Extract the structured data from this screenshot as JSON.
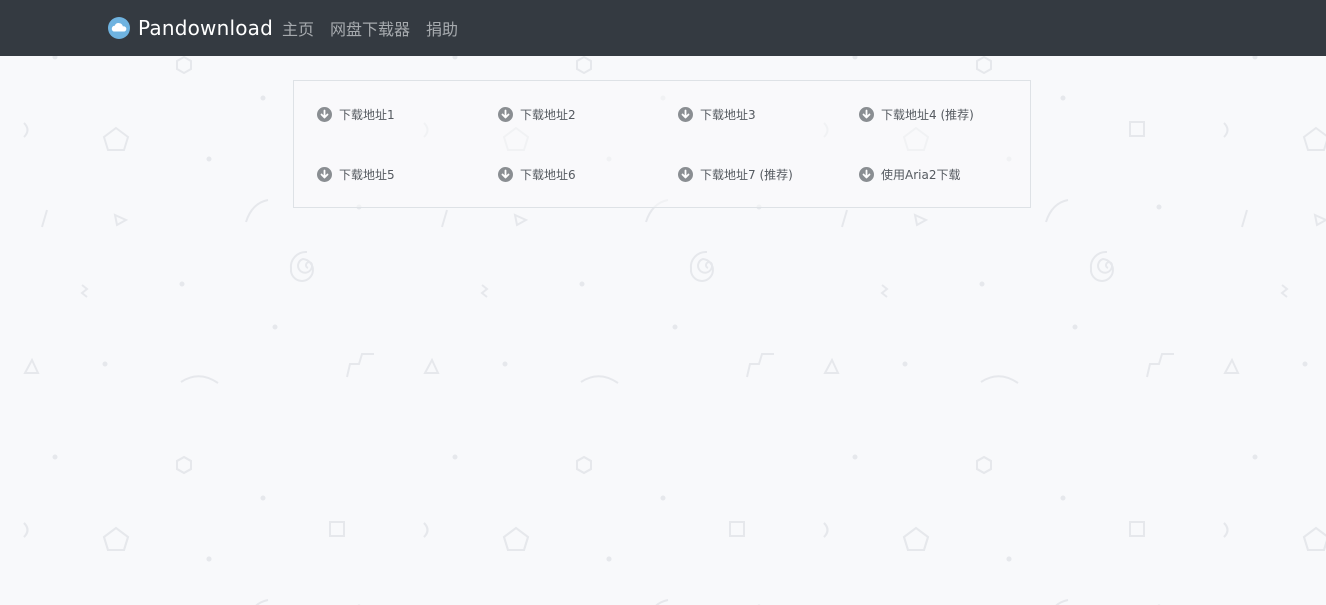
{
  "navbar": {
    "brand": "Pandownload",
    "links": [
      "主页",
      "网盘下载器",
      "捐助"
    ]
  },
  "downloads": [
    {
      "label": "下载地址1",
      "icon": "download-circle-icon"
    },
    {
      "label": "下载地址2",
      "icon": "download-circle-icon"
    },
    {
      "label": "下载地址3",
      "icon": "download-circle-icon"
    },
    {
      "label": "下载地址4 (推荐)",
      "icon": "download-circle-icon"
    },
    {
      "label": "下载地址5",
      "icon": "download-circle-icon"
    },
    {
      "label": "下载地址6",
      "icon": "download-circle-icon"
    },
    {
      "label": "下载地址7 (推荐)",
      "icon": "download-circle-icon"
    },
    {
      "label": "使用Aria2下载",
      "icon": "download-circle-icon"
    }
  ],
  "colors": {
    "navbar_bg": "#343a41",
    "page_bg": "#f8f9fb",
    "brand_text": "#ffffff",
    "nav_link": "#a6aaae",
    "logo_blue": "#6fb3e0",
    "icon_gray": "#8a8e92",
    "label_text": "#555a60"
  }
}
